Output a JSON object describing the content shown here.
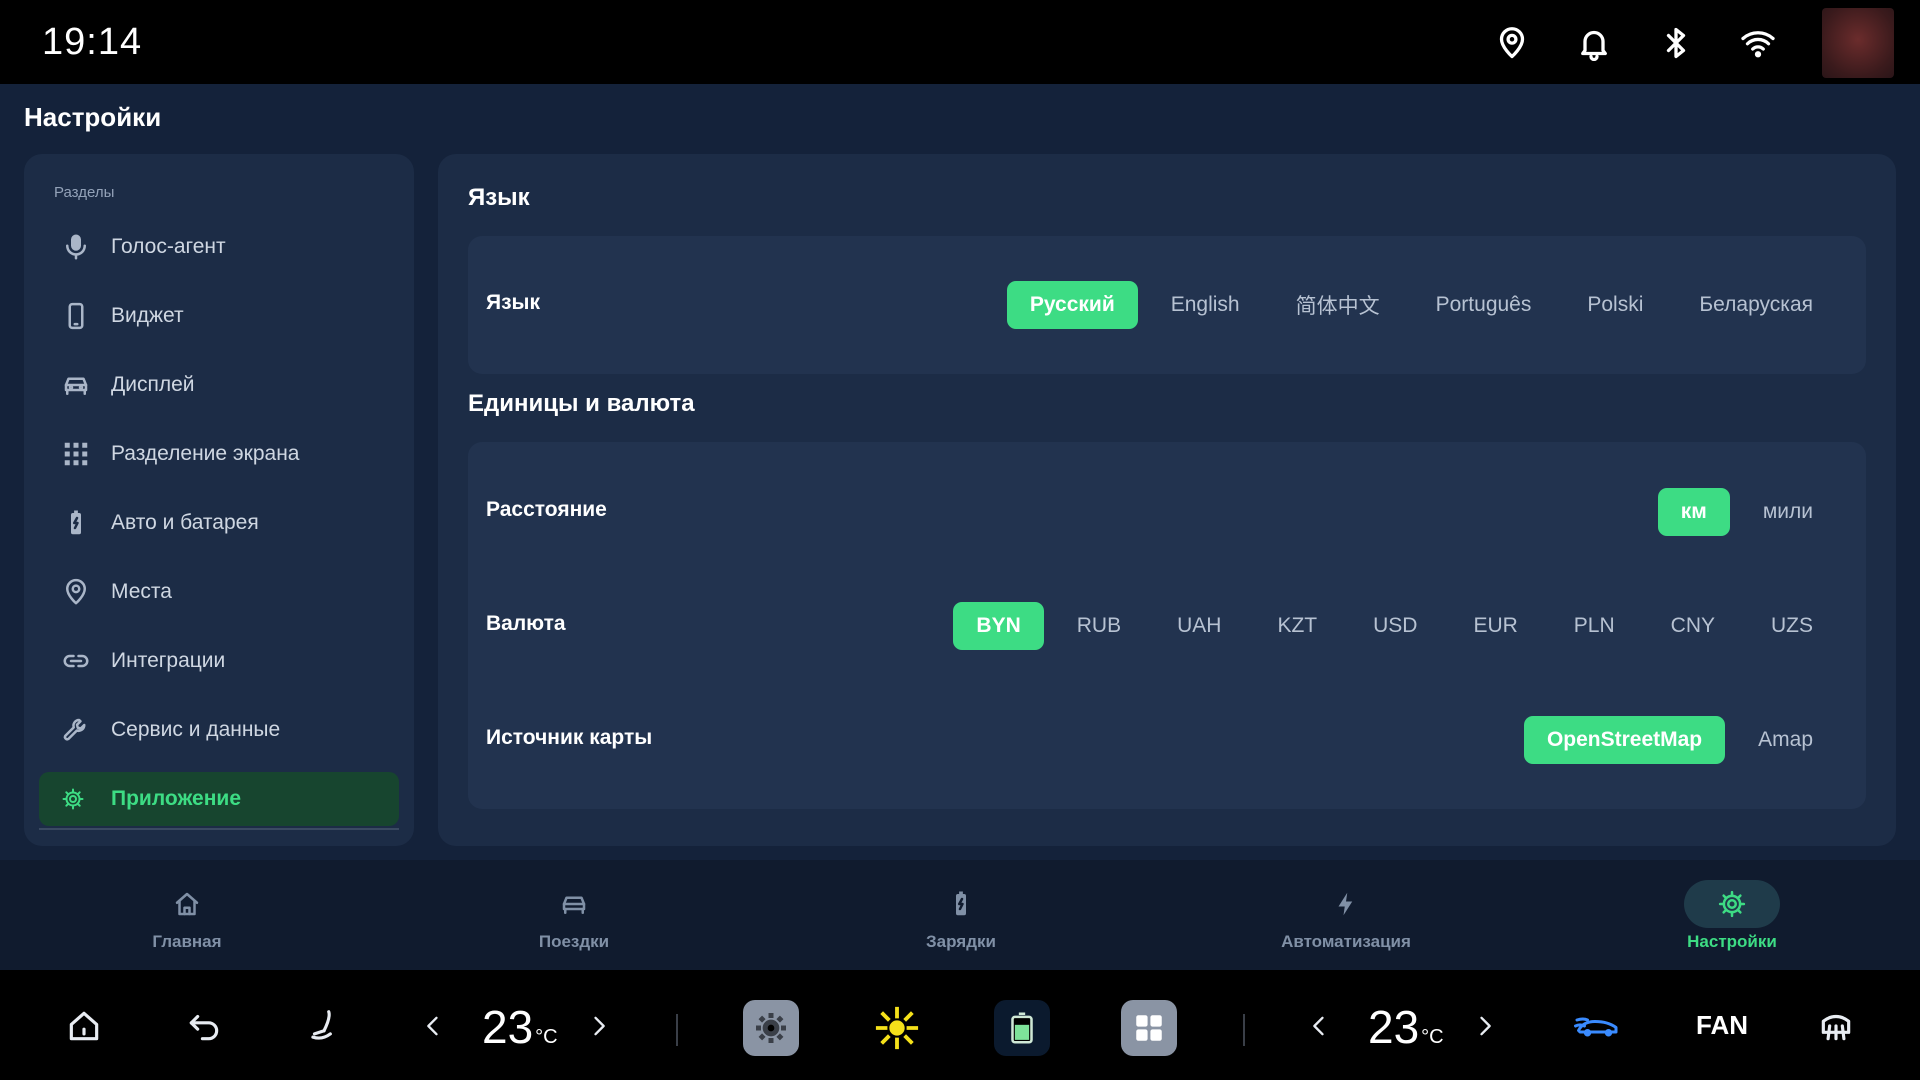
{
  "status": {
    "time": "19:14"
  },
  "page": {
    "title": "Настройки"
  },
  "sidebar": {
    "heading": "Разделы",
    "items": [
      {
        "label": "Голос-агент",
        "icon": "mic-icon"
      },
      {
        "label": "Виджет",
        "icon": "phone-icon"
      },
      {
        "label": "Дисплей",
        "icon": "car-icon"
      },
      {
        "label": "Разделение экрана",
        "icon": "grid-icon"
      },
      {
        "label": "Авто и батарея",
        "icon": "battery-icon"
      },
      {
        "label": "Места",
        "icon": "location-pin-icon"
      },
      {
        "label": "Интеграции",
        "icon": "link-icon"
      },
      {
        "label": "Сервис и данные",
        "icon": "wrench-icon"
      },
      {
        "label": "Приложение",
        "icon": "gear-icon",
        "active": true
      }
    ]
  },
  "language": {
    "section_title": "Язык",
    "row_label": "Язык",
    "options": [
      "Русский",
      "English",
      "简体中文",
      "Português",
      "Polski",
      "Беларуская"
    ],
    "selected": "Русский"
  },
  "units": {
    "section_title": "Единицы и валюта",
    "distance": {
      "label": "Расстояние",
      "options": [
        "км",
        "мили"
      ],
      "selected": "км"
    },
    "currency": {
      "label": "Валюта",
      "options": [
        "BYN",
        "RUB",
        "UAH",
        "KZT",
        "USD",
        "EUR",
        "PLN",
        "CNY",
        "UZS"
      ],
      "selected": "BYN"
    },
    "map_source": {
      "label": "Источник карты",
      "options": [
        "OpenStreetMap",
        "Amap"
      ],
      "selected": "OpenStreetMap"
    }
  },
  "bottom_nav": {
    "tabs": [
      {
        "label": "Главная",
        "icon": "home-icon"
      },
      {
        "label": "Поездки",
        "icon": "car-icon"
      },
      {
        "label": "Зарядки",
        "icon": "battery-icon"
      },
      {
        "label": "Автоматизация",
        "icon": "bolt-icon"
      },
      {
        "label": "Настройки",
        "icon": "gear-icon",
        "active": true
      }
    ]
  },
  "dock": {
    "left_temp": "23",
    "right_temp": "23",
    "temp_unit": "°C",
    "fan_label": "FAN"
  },
  "colors": {
    "accent": "#3ddc84",
    "background": "#14223a",
    "panel": "#1c2c46",
    "card": "#22334f"
  }
}
